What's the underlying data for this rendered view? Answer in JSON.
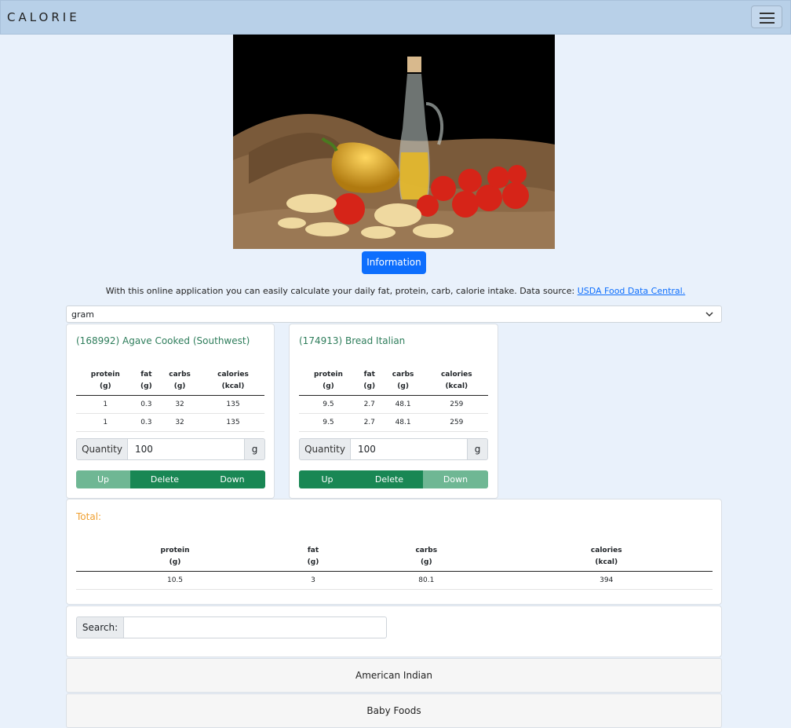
{
  "header": {
    "brand": "CALORIE",
    "menu_icon": "hamburger-icon"
  },
  "hero": {
    "alt": "olive oil bottle with peppers, tomatoes and pasta on burlap"
  },
  "info_button": "Information",
  "description": {
    "text": "With this online application you can easily calculate your daily fat, protein, carb, calorie intake. Data source: ",
    "link": "USDA Food Data Central."
  },
  "unit_select": {
    "value": "gram"
  },
  "columns": {
    "protein": "protein",
    "protein_unit": "(g)",
    "fat": "fat",
    "fat_unit": "(g)",
    "carbs": "carbs",
    "carbs_unit": "(g)",
    "calories": "calories",
    "calories_unit": "(kcal)"
  },
  "foods": [
    {
      "title": "(168992) Agave Cooked (Southwest)",
      "rows": [
        [
          "1",
          "0.3",
          "32",
          "135"
        ],
        [
          "1",
          "0.3",
          "32",
          "135"
        ]
      ],
      "quantity_label": "Quantity",
      "quantity": "100",
      "unit": "g",
      "up": "Up",
      "delete": "Delete",
      "down": "Down"
    },
    {
      "title": "(174913) Bread Italian",
      "rows": [
        [
          "9.5",
          "2.7",
          "48.1",
          "259"
        ],
        [
          "9.5",
          "2.7",
          "48.1",
          "259"
        ]
      ],
      "quantity_label": "Quantity",
      "quantity": "100",
      "unit": "g",
      "up": "Up",
      "delete": "Delete",
      "down": "Down"
    }
  ],
  "total": {
    "title": "Total:",
    "row": [
      "10.5",
      "3",
      "80.1",
      "394"
    ]
  },
  "search": {
    "label": "Search:",
    "value": ""
  },
  "categories": [
    "American Indian",
    "Baby Foods"
  ],
  "colors": {
    "navbar": "#b8d0e8",
    "primary": "#0d6efd",
    "success": "#198754",
    "success_light": "#6fb794",
    "total_title": "#f0a030"
  }
}
